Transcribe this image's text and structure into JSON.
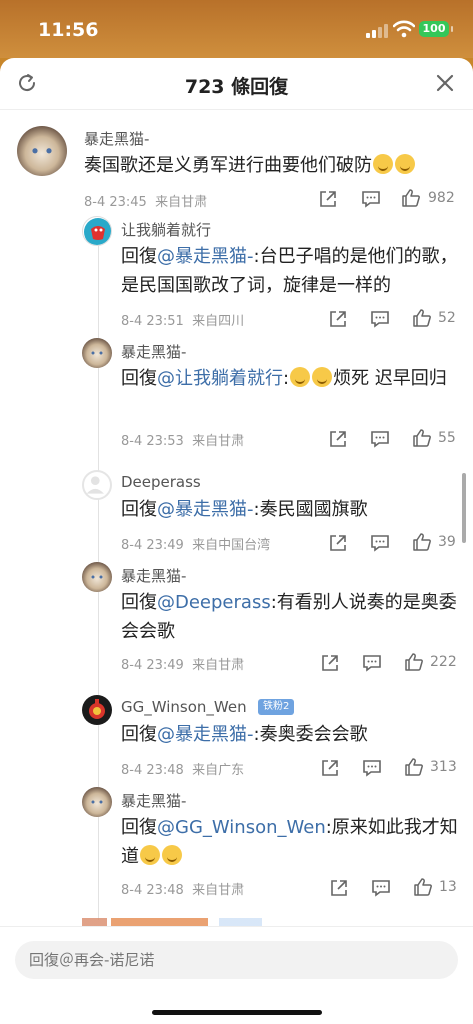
{
  "status_bar": {
    "time": "11:56",
    "battery": "100"
  },
  "header": {
    "title": "723 條回復"
  },
  "comments": [
    {
      "user": "暴走黑猫-",
      "text": "奏国歌还是义勇军进行曲要他们破防",
      "date": "8-4 23:45",
      "location": "来自甘肃",
      "likes": "982"
    },
    {
      "user": "让我躺着就行",
      "prefix": "回復",
      "mention": "@暴走黑猫-",
      "text": ":台巴子唱的是他们的歌，是民国国歌改了词，旋律是一样的",
      "date": "8-4 23:51",
      "location": "来自四川",
      "likes": "52"
    },
    {
      "user": "暴走黑猫-",
      "prefix": "回復",
      "mention": "@让我躺着就行",
      "text_a": ":",
      "text_b": "烦死 迟早回归",
      "date": "8-4 23:53",
      "location": "来自甘肃",
      "likes": "55"
    },
    {
      "user": "Deeperass",
      "prefix": "回復",
      "mention": "@暴走黑猫-",
      "text": ":奏民國國旗歌",
      "date": "8-4 23:49",
      "location": "来自中国台湾",
      "likes": "39"
    },
    {
      "user": "暴走黑猫-",
      "prefix": "回復",
      "mention": "@Deeperass",
      "text": ":有看别人说奏的是奥委会会歌",
      "date": "8-4 23:49",
      "location": "来自甘肃",
      "likes": "222"
    },
    {
      "user": "GG_Winson_Wen",
      "badge": "铁粉2",
      "prefix": "回復",
      "mention": "@暴走黑猫-",
      "text": ":奏奥委会会歌",
      "date": "8-4 23:48",
      "location": "来自广东",
      "likes": "313"
    },
    {
      "user": "暴走黑猫-",
      "prefix": "回復",
      "mention": "@GG_Winson_Wen",
      "text": ":原来如此我才知道",
      "date": "8-4 23:48",
      "location": "来自甘肃",
      "likes": "13"
    }
  ],
  "reply_input": {
    "placeholder": "回復＠再会-诺尼诺"
  },
  "icons": {
    "refresh": "refresh-icon",
    "close": "close-icon",
    "share": "share-icon",
    "comment": "comment-icon",
    "like": "thumbs-up-icon"
  },
  "colors": {
    "mention": "#3d6ea8",
    "battery": "#34c759",
    "status_bar": "#c8862a"
  }
}
